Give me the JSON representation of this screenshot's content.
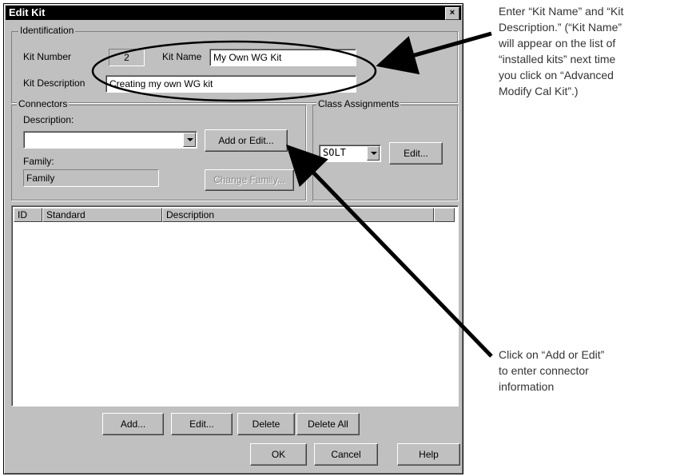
{
  "dialog": {
    "title": "Edit Kit",
    "close_glyph": "×"
  },
  "identification": {
    "group_label": "Identification",
    "kit_number_label": "Kit Number",
    "kit_number_value": "2",
    "kit_name_label": "Kit Name",
    "kit_name_value": "My Own WG Kit",
    "kit_description_label": "Kit Description",
    "kit_description_value": "Creating my own WG kit"
  },
  "connectors": {
    "group_label": "Connectors",
    "description_label": "Description:",
    "description_value": "",
    "add_edit_button": "Add or Edit...",
    "family_label": "Family:",
    "family_value": "Family",
    "change_family_button": "Change Family..."
  },
  "class_assignments": {
    "group_label": "Class Assignments",
    "selected": "SOLT",
    "edit_button": "Edit..."
  },
  "standards_table": {
    "columns": [
      "ID",
      "Standard",
      "Description"
    ],
    "rows": []
  },
  "buttons": {
    "add": "Add...",
    "edit": "Edit...",
    "delete": "Delete",
    "delete_all": "Delete All",
    "ok": "OK",
    "cancel": "Cancel",
    "help": "Help"
  },
  "annotations": {
    "top_right": [
      "Enter “Kit Name” and “Kit",
      "Description.” (“Kit Name”",
      "will appear on the list of",
      "“installed kits” next time",
      "you click on “Advanced",
      "Modify Cal Kit”.)"
    ],
    "bottom_right": [
      "Click on “Add or Edit”",
      "to enter connector",
      "information"
    ]
  }
}
